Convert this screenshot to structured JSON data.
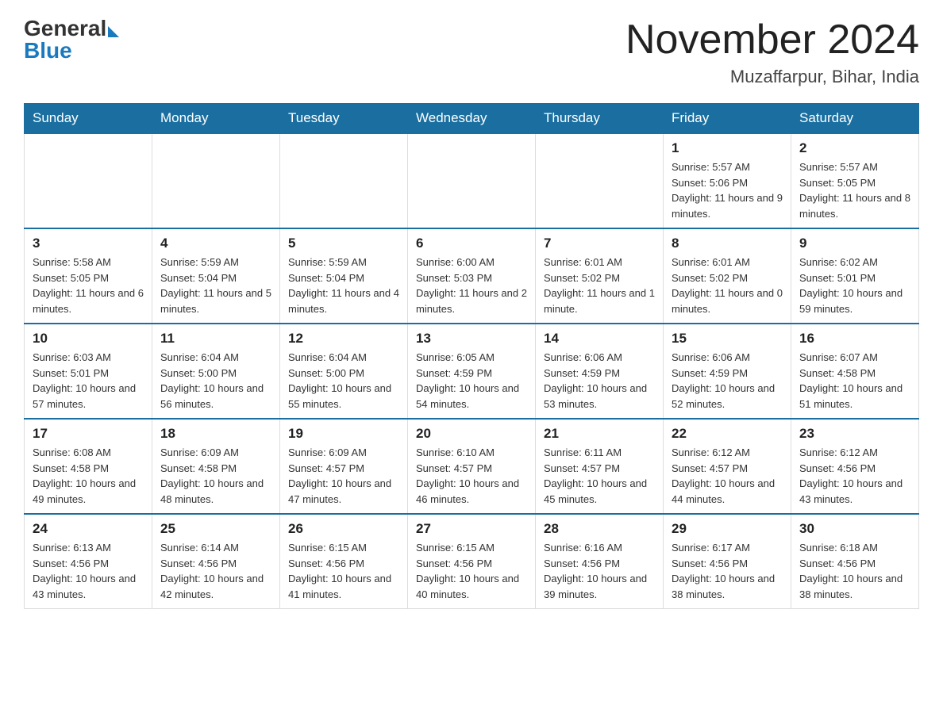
{
  "header": {
    "logo_general": "General",
    "logo_blue": "Blue",
    "month_title": "November 2024",
    "location": "Muzaffarpur, Bihar, India"
  },
  "weekdays": [
    "Sunday",
    "Monday",
    "Tuesday",
    "Wednesday",
    "Thursday",
    "Friday",
    "Saturday"
  ],
  "weeks": [
    [
      {
        "day": "",
        "info": ""
      },
      {
        "day": "",
        "info": ""
      },
      {
        "day": "",
        "info": ""
      },
      {
        "day": "",
        "info": ""
      },
      {
        "day": "",
        "info": ""
      },
      {
        "day": "1",
        "info": "Sunrise: 5:57 AM\nSunset: 5:06 PM\nDaylight: 11 hours and 9 minutes."
      },
      {
        "day": "2",
        "info": "Sunrise: 5:57 AM\nSunset: 5:05 PM\nDaylight: 11 hours and 8 minutes."
      }
    ],
    [
      {
        "day": "3",
        "info": "Sunrise: 5:58 AM\nSunset: 5:05 PM\nDaylight: 11 hours and 6 minutes."
      },
      {
        "day": "4",
        "info": "Sunrise: 5:59 AM\nSunset: 5:04 PM\nDaylight: 11 hours and 5 minutes."
      },
      {
        "day": "5",
        "info": "Sunrise: 5:59 AM\nSunset: 5:04 PM\nDaylight: 11 hours and 4 minutes."
      },
      {
        "day": "6",
        "info": "Sunrise: 6:00 AM\nSunset: 5:03 PM\nDaylight: 11 hours and 2 minutes."
      },
      {
        "day": "7",
        "info": "Sunrise: 6:01 AM\nSunset: 5:02 PM\nDaylight: 11 hours and 1 minute."
      },
      {
        "day": "8",
        "info": "Sunrise: 6:01 AM\nSunset: 5:02 PM\nDaylight: 11 hours and 0 minutes."
      },
      {
        "day": "9",
        "info": "Sunrise: 6:02 AM\nSunset: 5:01 PM\nDaylight: 10 hours and 59 minutes."
      }
    ],
    [
      {
        "day": "10",
        "info": "Sunrise: 6:03 AM\nSunset: 5:01 PM\nDaylight: 10 hours and 57 minutes."
      },
      {
        "day": "11",
        "info": "Sunrise: 6:04 AM\nSunset: 5:00 PM\nDaylight: 10 hours and 56 minutes."
      },
      {
        "day": "12",
        "info": "Sunrise: 6:04 AM\nSunset: 5:00 PM\nDaylight: 10 hours and 55 minutes."
      },
      {
        "day": "13",
        "info": "Sunrise: 6:05 AM\nSunset: 4:59 PM\nDaylight: 10 hours and 54 minutes."
      },
      {
        "day": "14",
        "info": "Sunrise: 6:06 AM\nSunset: 4:59 PM\nDaylight: 10 hours and 53 minutes."
      },
      {
        "day": "15",
        "info": "Sunrise: 6:06 AM\nSunset: 4:59 PM\nDaylight: 10 hours and 52 minutes."
      },
      {
        "day": "16",
        "info": "Sunrise: 6:07 AM\nSunset: 4:58 PM\nDaylight: 10 hours and 51 minutes."
      }
    ],
    [
      {
        "day": "17",
        "info": "Sunrise: 6:08 AM\nSunset: 4:58 PM\nDaylight: 10 hours and 49 minutes."
      },
      {
        "day": "18",
        "info": "Sunrise: 6:09 AM\nSunset: 4:58 PM\nDaylight: 10 hours and 48 minutes."
      },
      {
        "day": "19",
        "info": "Sunrise: 6:09 AM\nSunset: 4:57 PM\nDaylight: 10 hours and 47 minutes."
      },
      {
        "day": "20",
        "info": "Sunrise: 6:10 AM\nSunset: 4:57 PM\nDaylight: 10 hours and 46 minutes."
      },
      {
        "day": "21",
        "info": "Sunrise: 6:11 AM\nSunset: 4:57 PM\nDaylight: 10 hours and 45 minutes."
      },
      {
        "day": "22",
        "info": "Sunrise: 6:12 AM\nSunset: 4:57 PM\nDaylight: 10 hours and 44 minutes."
      },
      {
        "day": "23",
        "info": "Sunrise: 6:12 AM\nSunset: 4:56 PM\nDaylight: 10 hours and 43 minutes."
      }
    ],
    [
      {
        "day": "24",
        "info": "Sunrise: 6:13 AM\nSunset: 4:56 PM\nDaylight: 10 hours and 43 minutes."
      },
      {
        "day": "25",
        "info": "Sunrise: 6:14 AM\nSunset: 4:56 PM\nDaylight: 10 hours and 42 minutes."
      },
      {
        "day": "26",
        "info": "Sunrise: 6:15 AM\nSunset: 4:56 PM\nDaylight: 10 hours and 41 minutes."
      },
      {
        "day": "27",
        "info": "Sunrise: 6:15 AM\nSunset: 4:56 PM\nDaylight: 10 hours and 40 minutes."
      },
      {
        "day": "28",
        "info": "Sunrise: 6:16 AM\nSunset: 4:56 PM\nDaylight: 10 hours and 39 minutes."
      },
      {
        "day": "29",
        "info": "Sunrise: 6:17 AM\nSunset: 4:56 PM\nDaylight: 10 hours and 38 minutes."
      },
      {
        "day": "30",
        "info": "Sunrise: 6:18 AM\nSunset: 4:56 PM\nDaylight: 10 hours and 38 minutes."
      }
    ]
  ]
}
